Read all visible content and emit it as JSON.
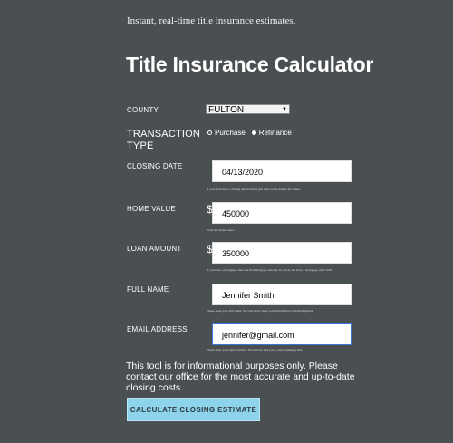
{
  "header": {
    "tagline": "Instant, real-time title insurance estimates.",
    "title": "Title Insurance Calculator"
  },
  "form": {
    "county": {
      "label": "COUNTY",
      "selected": "FULTON"
    },
    "transaction_type": {
      "label_line1": "TRANSACTION",
      "label_line2": "TYPE",
      "options": [
        "Purchase",
        "Refinance"
      ],
      "selected": "Refinance"
    },
    "closing_date": {
      "label": "CLOSING DATE",
      "value": "04/13/2020",
      "help": "If you don't have a closing date in mind, just enter some date in the future."
    },
    "home_value": {
      "label": "HOME VALUE",
      "prefix": "$",
      "value": "450000",
      "help": "Enter the home value."
    },
    "loan_amount": {
      "label": "LOAN AMOUNT",
      "prefix": "$",
      "value": "350000",
      "help": "If you have a mortgage, enter the first mortgage amount. If you do not have a mortgage, enter 0.00."
    },
    "full_name": {
      "label": "FULL NAME",
      "value": "Jennifer Smith",
      "help": "Please enter your full name. We will never share your information with third parties."
    },
    "email": {
      "label": "EMAIL ADDRESS",
      "value": "jennifer@gmail.com",
      "help": "Please enter your email address. We will not add you to any marketing lists."
    }
  },
  "disclaimer": "This tool is for informational purposes only. Please contact our office for the most accurate and up-to-date closing costs.",
  "submit_label": "CALCULATE CLOSING ESTIMATE"
}
